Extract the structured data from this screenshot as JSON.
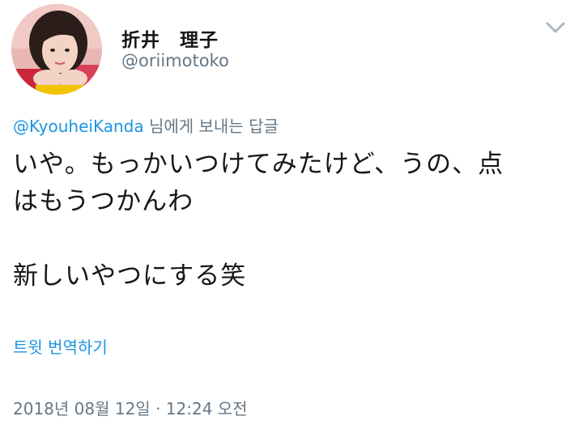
{
  "user": {
    "display_name": "折井　理子",
    "handle": "@oriimotoko"
  },
  "reply": {
    "mention": "@KyouheiKanda",
    "suffix": " 님에게 보내는 답글"
  },
  "tweet": {
    "line1": "いや。もっかいつけてみたけど、うの、点",
    "line2": "はもうつかんわ",
    "line3": "新しいやつにする笑"
  },
  "translate_label": "트윗 번역하기",
  "timestamp": "2018년 08월 12일 · 12:24 오전",
  "icons": {
    "menu": "chevron-down-icon",
    "avatar": "profile-photo"
  },
  "colors": {
    "link": "#1b95e0",
    "secondary": "#657786",
    "text": "#14171a"
  }
}
